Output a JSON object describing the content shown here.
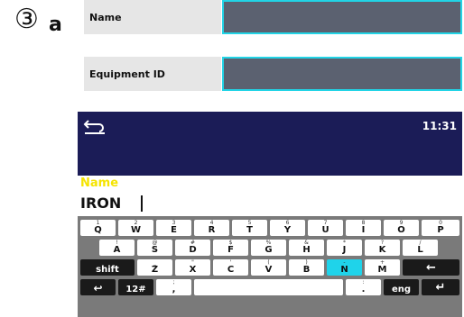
{
  "step": {
    "number": "③",
    "letter": "a"
  },
  "fields": [
    {
      "label": "Name",
      "value": ""
    },
    {
      "label": "Equipment ID",
      "value": ""
    }
  ],
  "device": {
    "clock": "11:31",
    "edit_title": "Name",
    "entry_value": "IRON"
  },
  "keyboard": {
    "row1": [
      {
        "main": "Q",
        "sub": "1"
      },
      {
        "main": "W",
        "sub": "2"
      },
      {
        "main": "E",
        "sub": "3"
      },
      {
        "main": "R",
        "sub": "4"
      },
      {
        "main": "T",
        "sub": "5"
      },
      {
        "main": "Y",
        "sub": "6"
      },
      {
        "main": "U",
        "sub": "7"
      },
      {
        "main": "I",
        "sub": "8"
      },
      {
        "main": "O",
        "sub": "9"
      },
      {
        "main": "P",
        "sub": "0"
      }
    ],
    "row2": [
      {
        "main": "A",
        "sub": "!"
      },
      {
        "main": "S",
        "sub": "@"
      },
      {
        "main": "D",
        "sub": "#"
      },
      {
        "main": "F",
        "sub": "$"
      },
      {
        "main": "G",
        "sub": "%"
      },
      {
        "main": "H",
        "sub": "&"
      },
      {
        "main": "J",
        "sub": "*"
      },
      {
        "main": "K",
        "sub": "?"
      },
      {
        "main": "L",
        "sub": "/"
      }
    ],
    "row3": {
      "shift": "shift",
      "letters": [
        {
          "main": "Z",
          "sub": "_"
        },
        {
          "main": "X",
          "sub": "\""
        },
        {
          "main": "C",
          "sub": "'"
        },
        {
          "main": "V",
          "sub": "("
        },
        {
          "main": "B",
          "sub": ")"
        },
        {
          "main": "N",
          "sub": "-"
        },
        {
          "main": "M",
          "sub": "+"
        }
      ],
      "backspace": "←"
    },
    "row4": {
      "back": "↩",
      "mode": "12#",
      "comma_sub": ";",
      "comma": ",",
      "period_sub": ":",
      "period": ".",
      "lang": "eng",
      "enter": "↵"
    }
  },
  "colors": {
    "accent": "#1fd3ea",
    "header": "#1b1c57",
    "title": "#f5e400"
  }
}
